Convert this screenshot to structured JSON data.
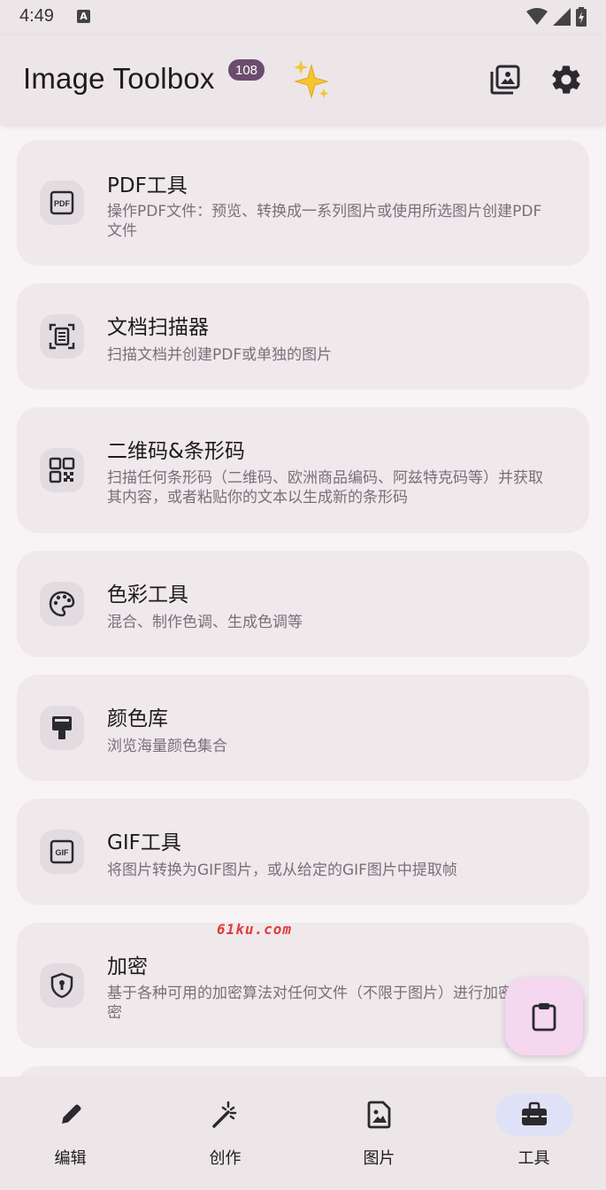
{
  "status_bar": {
    "time": "4:49",
    "notification_letter": "A"
  },
  "app_bar": {
    "title": "Image Toolbox",
    "badge": "108",
    "icons": [
      "sparkles-icon",
      "gallery-icon",
      "gear-icon"
    ]
  },
  "tools": [
    {
      "icon": "pdf-icon",
      "title": "PDF工具",
      "description": "操作PDF文件：预览、转换成一系列图片或使用所选图片创建PDF文件"
    },
    {
      "icon": "document-scanner-icon",
      "title": "文档扫描器",
      "description": "扫描文档并创建PDF或单独的图片"
    },
    {
      "icon": "qr-code-icon",
      "title": "二维码&条形码",
      "description": "扫描任何条形码（二维码、欧洲商品编码、阿兹特克码等）并获取其内容，或者粘贴你的文本以生成新的条形码"
    },
    {
      "icon": "palette-icon",
      "title": "色彩工具",
      "description": "混合、制作色调、生成色调等"
    },
    {
      "icon": "paint-bucket-icon",
      "title": "颜色库",
      "description": "浏览海量颜色集合"
    },
    {
      "icon": "gif-icon",
      "title": "GIF工具",
      "description": "将图片转换为GIF图片，或从给定的GIF图片中提取帧"
    },
    {
      "icon": "shield-lock-icon",
      "title": "加密",
      "description": "基于各种可用的加密算法对任何文件（不限于图片）进行加密和解密"
    }
  ],
  "watermark": "61ku.com",
  "fab": {
    "icon": "clipboard-icon"
  },
  "bottom_nav": [
    {
      "icon": "pencil-icon",
      "label": "编辑",
      "active": false
    },
    {
      "icon": "magic-wand-icon",
      "label": "创作",
      "active": false
    },
    {
      "icon": "image-icon",
      "label": "图片",
      "active": false
    },
    {
      "icon": "toolbox-icon",
      "label": "工具",
      "active": true
    }
  ],
  "colors": {
    "surface": "#ece6e9",
    "card": "#efe9ec",
    "badge": "#6b4c6e",
    "fab": "#f5d7ef",
    "nav_active": "#dfe1f6"
  }
}
